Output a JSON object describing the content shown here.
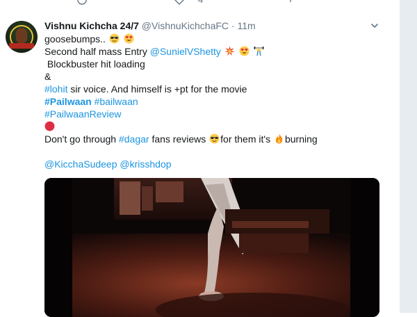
{
  "prev_tweet": {
    "like_count": "4"
  },
  "tweet": {
    "display_name": "Vishnu Kichcha 24/7",
    "handle": "@VishnuKichchaFC",
    "separator": "·",
    "time": "11m",
    "lines": {
      "l1": "goosebumps..",
      "l2_text": "Second half mass Entry ",
      "l2_mention": "@SunielVShetty",
      "l3": "Blockbuster hit loading",
      "l4": "&",
      "l5_tag": "#lohit",
      "l5_text": " sir voice. And himself is +pt for the movie",
      "l6_tag1": "#Pailwaan",
      "l6_tag2": "#bailwaan",
      "l7_tag": "#PailwaanReview",
      "l9_text1": "Don't go through ",
      "l9_tag": "#dagar",
      "l9_text2": " fans reviews ",
      "l9_text3": "for them it's ",
      "l9_text4": "burning",
      "l11_mention1": "@KicchaSudeep",
      "l11_mention2": "@krisshdop"
    }
  },
  "icons": {
    "sunglasses": "smiling-face-with-sunglasses-emoji",
    "heart_eyes": "smiling-face-with-heart-eyes-emoji",
    "collision": "collision-emoji",
    "weightlifter": "person-lifting-weights-emoji",
    "red_circle": "red-circle-emoji",
    "fire": "fire-emoji",
    "caret": "chevron-down-icon"
  },
  "colors": {
    "link": "#1b95e0",
    "text": "#14171a",
    "muted": "#657786",
    "rail": "#e6ecf0"
  }
}
